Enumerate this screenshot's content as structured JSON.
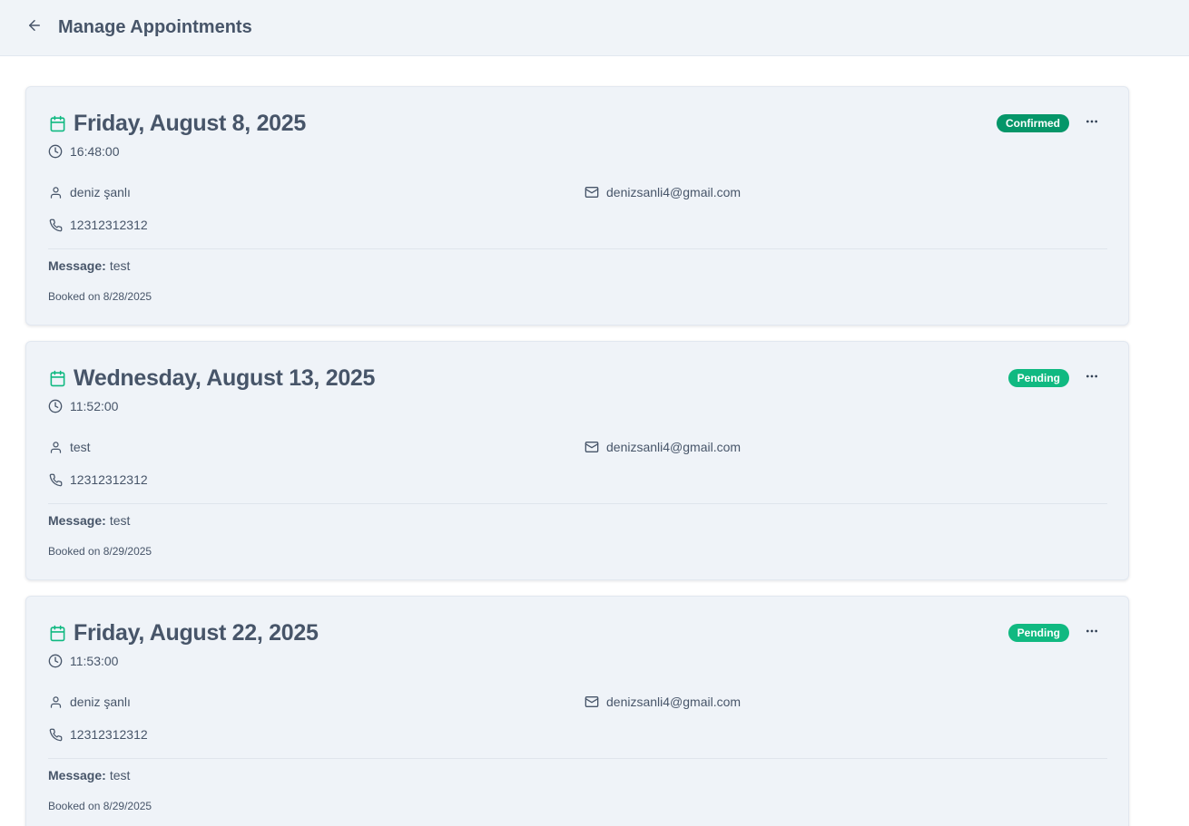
{
  "header": {
    "title": "Manage Appointments",
    "back_icon": "arrow-left-icon"
  },
  "colors": {
    "accent": "#10b981",
    "confirmed": "#059669",
    "pending": "#10b981",
    "text": "#475569"
  },
  "appointments": [
    {
      "date": "Friday, August 8, 2025",
      "time": "16:48:00",
      "name": "deniz şanlı",
      "email": "denizsanli4@gmail.com",
      "phone": "12312312312",
      "message_label": "Message:",
      "message": "test",
      "booked": "Booked on 8/28/2025",
      "status": "Confirmed",
      "status_color": "#059669"
    },
    {
      "date": "Wednesday, August 13, 2025",
      "time": "11:52:00",
      "name": "test",
      "email": "denizsanli4@gmail.com",
      "phone": "12312312312",
      "message_label": "Message:",
      "message": "test",
      "booked": "Booked on 8/29/2025",
      "status": "Pending",
      "status_color": "#10b981"
    },
    {
      "date": "Friday, August 22, 2025",
      "time": "11:53:00",
      "name": "deniz şanlı",
      "email": "denizsanli4@gmail.com",
      "phone": "12312312312",
      "message_label": "Message:",
      "message": "test",
      "booked": "Booked on 8/29/2025",
      "status": "Pending",
      "status_color": "#10b981"
    }
  ]
}
